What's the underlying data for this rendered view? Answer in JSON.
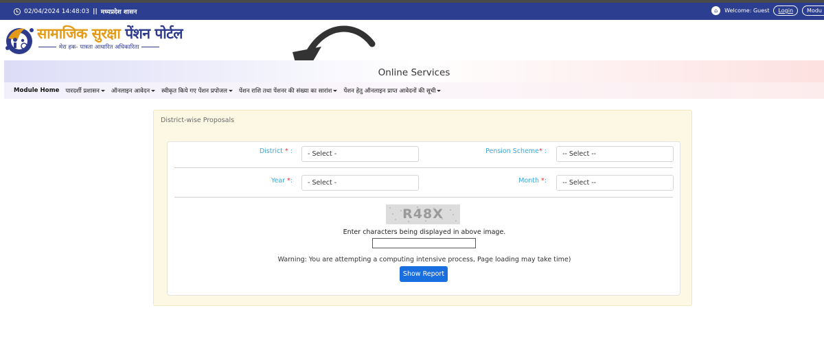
{
  "topbar": {
    "datetime": "02/04/2024 14:48:03",
    "separator": "||",
    "department": "मध्यप्रदेश शासन",
    "welcome": "Welcome: Guest",
    "login": "Login",
    "module": "Modu"
  },
  "logo": {
    "title_part1": "सामाजिक सुरक्षा",
    "title_part2": "पेंशन पोर्टल",
    "subtitle": "मेरा हक- पात्रता आधारित अधिकारिता"
  },
  "banner": {
    "title": "Online Services"
  },
  "menu": {
    "items": [
      {
        "label": "Module Home",
        "has_dropdown": false
      },
      {
        "label": "पारदर्शी प्रशासन",
        "has_dropdown": true
      },
      {
        "label": "ऑनलाइन आवेदन",
        "has_dropdown": true
      },
      {
        "label": "स्वीकृत किये गए पेंशन प्रपोजल",
        "has_dropdown": true
      },
      {
        "label": "पेंशन राशि तथा पेंशनर की संख्या का सारांश",
        "has_dropdown": true
      },
      {
        "label": "पेंशन हेतु ऑनलाइन प्राप्त आवेदनों की सूची",
        "has_dropdown": true
      }
    ]
  },
  "form": {
    "heading": "District-wise Proposals",
    "district_label": "District",
    "district_value": "- Select -",
    "scheme_label": "Pension Scheme",
    "scheme_value": "-- Select --",
    "year_label": "Year",
    "year_value": "- Select -",
    "month_label": "Month",
    "month_value": "-- Select --",
    "required_mark": "*",
    "captcha_text": "R48X",
    "captcha_instruction": "Enter characters being displayed in above image.",
    "captcha_input_value": "",
    "warning": "Warning: You are attempting a computing intensive process, Page loading may take time)",
    "submit_label": "Show Report"
  },
  "colors": {
    "topbar": "#2c3e8f",
    "label": "#3aa6d8",
    "required": "#e03030",
    "button": "#1a6fe0",
    "card_bg": "#fcf8e3"
  }
}
